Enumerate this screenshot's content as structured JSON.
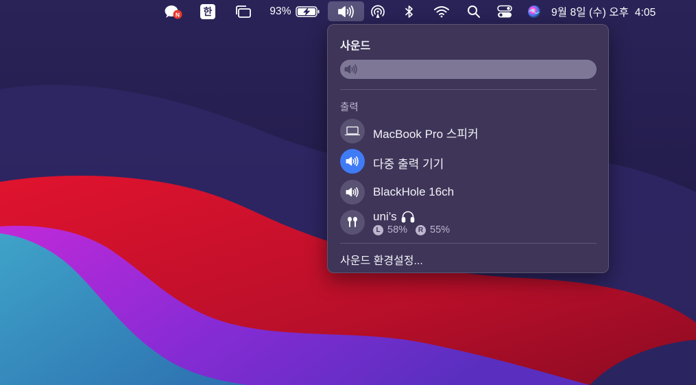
{
  "menubar": {
    "battery_percent": "93%",
    "input_method": "한",
    "datetime": "9월 8일 (수) 오후  4:05",
    "notification_badge": "N",
    "icons": [
      "kakaotalk-icon",
      "input-method-icon",
      "window-switch-icon",
      "battery-charging-icon",
      "volume-icon",
      "airdrop-icon",
      "bluetooth-icon",
      "wifi-icon",
      "search-icon",
      "control-center-icon",
      "siri-icon"
    ]
  },
  "sound_panel": {
    "title": "사운드",
    "volume_level": 0.0,
    "output_section_label": "출력",
    "devices": [
      {
        "label": "MacBook Pro 스피커",
        "icon": "laptop-icon",
        "selected": false
      },
      {
        "label": "다중 출력 기기",
        "icon": "speaker-icon",
        "selected": true
      },
      {
        "label": "BlackHole 16ch",
        "icon": "speaker-icon",
        "selected": false
      },
      {
        "label": "uni’s",
        "icon": "airpods-icon",
        "selected": false,
        "left_label": "L",
        "left_battery": "58%",
        "right_label": "R",
        "right_battery": "55%"
      }
    ],
    "settings_link": "사운드 환경설정..."
  },
  "colors": {
    "accent": "#3f7bf5",
    "panel_bg": "#3e3558"
  }
}
